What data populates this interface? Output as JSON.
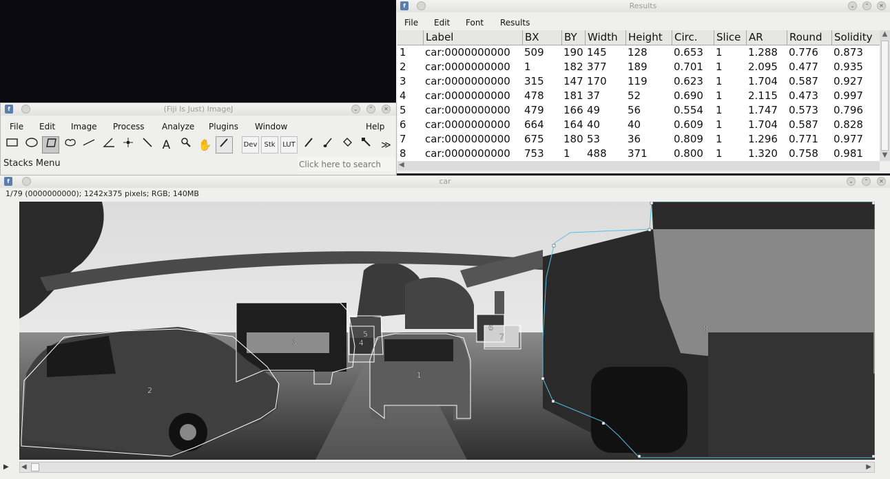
{
  "results": {
    "title": "Results",
    "menu": [
      "File",
      "Edit",
      "Font",
      "Results"
    ],
    "columns": [
      "Label",
      "BX",
      "BY",
      "Width",
      "Height",
      "Circ.",
      "Slice",
      "AR",
      "Round",
      "Solidity"
    ],
    "rows": [
      [
        "1",
        "car:0000000000",
        "509",
        "190",
        "145",
        "128",
        "0.653",
        "1",
        "1.288",
        "0.776",
        "0.873"
      ],
      [
        "2",
        "car:0000000000",
        "1",
        "182",
        "377",
        "189",
        "0.701",
        "1",
        "2.095",
        "0.477",
        "0.935"
      ],
      [
        "3",
        "car:0000000000",
        "315",
        "147",
        "170",
        "119",
        "0.623",
        "1",
        "1.704",
        "0.587",
        "0.927"
      ],
      [
        "4",
        "car:0000000000",
        "478",
        "181",
        "37",
        "52",
        "0.690",
        "1",
        "2.115",
        "0.473",
        "0.997"
      ],
      [
        "5",
        "car:0000000000",
        "479",
        "166",
        "49",
        "56",
        "0.554",
        "1",
        "1.747",
        "0.573",
        "0.796"
      ],
      [
        "6",
        "car:0000000000",
        "664",
        "164",
        "40",
        "40",
        "0.609",
        "1",
        "1.704",
        "0.587",
        "0.828"
      ],
      [
        "7",
        "car:0000000000",
        "675",
        "180",
        "53",
        "36",
        "0.809",
        "1",
        "1.296",
        "0.771",
        "0.977"
      ],
      [
        "8",
        "car:0000000000",
        "753",
        "1",
        "488",
        "371",
        "0.800",
        "1",
        "1.320",
        "0.758",
        "0.981"
      ]
    ]
  },
  "imagej": {
    "title": "(Fiji Is Just) ImageJ",
    "menu": [
      "File",
      "Edit",
      "Image",
      "Process",
      "Analyze",
      "Plugins",
      "Window",
      "Help"
    ],
    "tools": [
      "rectangle-tool",
      "oval-tool",
      "polygon-tool",
      "freehand-tool",
      "line-tool",
      "angle-tool",
      "point-tool",
      "wand-tool",
      "text-tool",
      "magnifier-tool",
      "hand-tool",
      "color-picker-tool"
    ],
    "text_tool_label": "A",
    "buttons": [
      "Dev",
      "Stk",
      "LUT"
    ],
    "more_label": "≫",
    "status": "Stacks Menu",
    "search_placeholder": "Click here to search"
  },
  "image_window": {
    "title": "car",
    "info": "1/79 (0000000000); 1242x375 pixels; RGB; 140MB",
    "roi_labels": [
      "1",
      "2",
      "3",
      "4",
      "5",
      "6",
      "7",
      "8"
    ]
  },
  "colors": {
    "roi_stroke": "#ffffff",
    "selected_roi": "#4fc3e6",
    "window_bg": "#efefee"
  }
}
